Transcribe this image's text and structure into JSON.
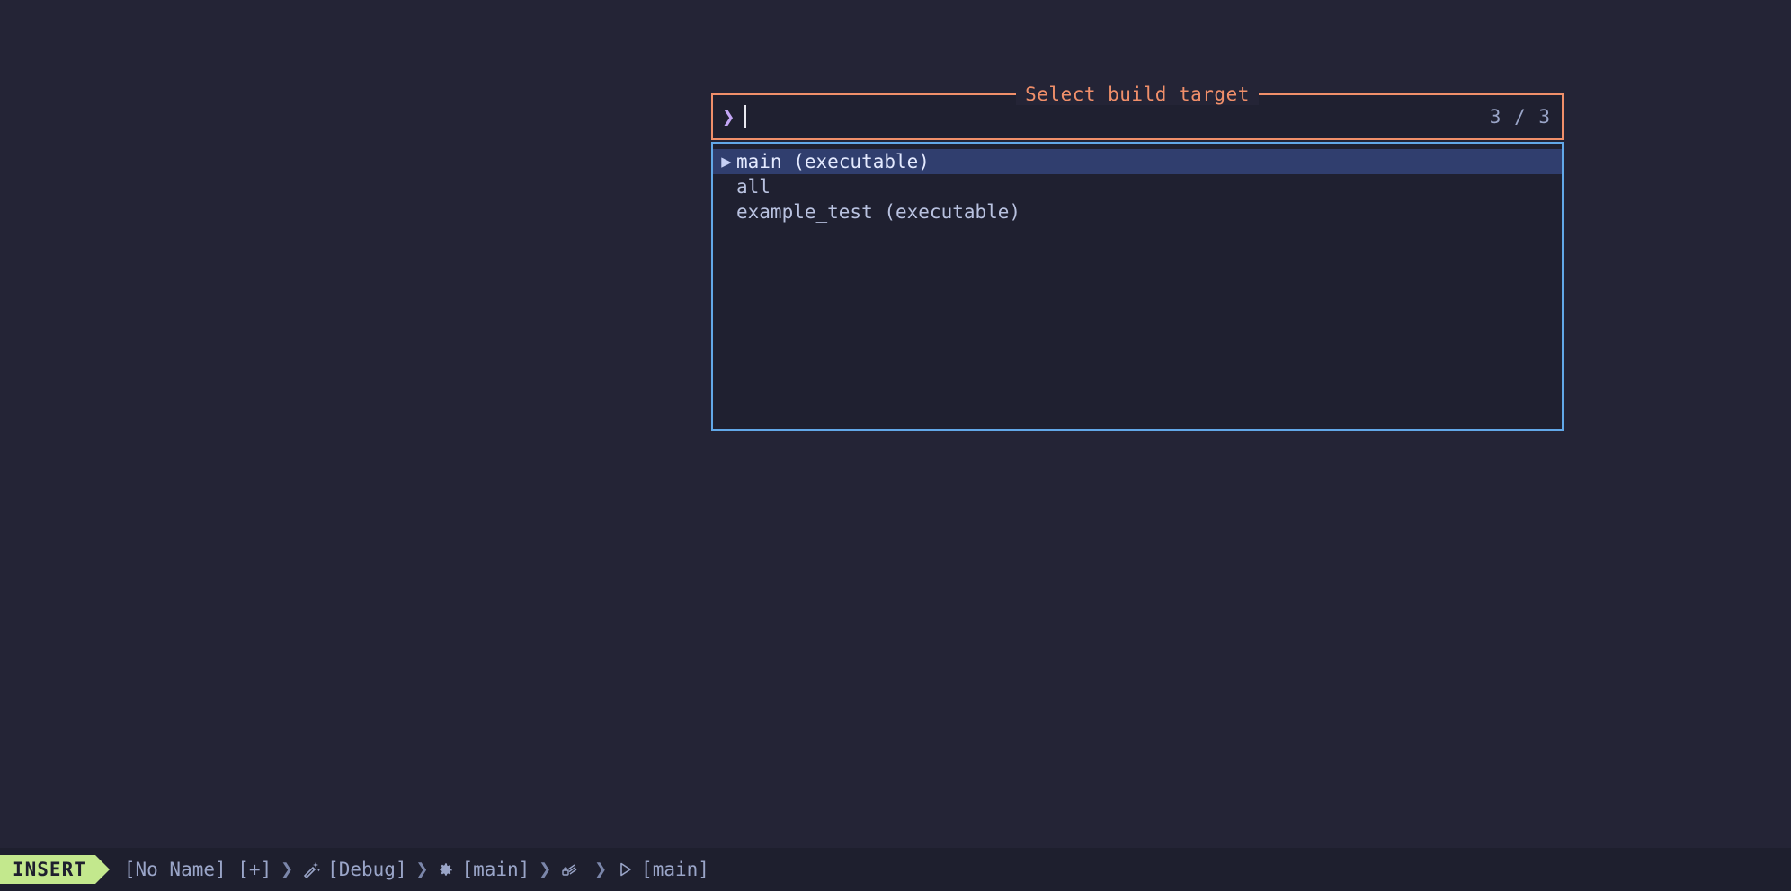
{
  "window": {
    "background_color": "#242436"
  },
  "picker": {
    "title": "Select build target",
    "title_color": "#f08f6a",
    "prompt": {
      "chevron": "❯",
      "value": "",
      "placeholder": "",
      "counter": "3 / 3",
      "border_color": "#f08f6a"
    },
    "results": {
      "border_color": "#62a8e8",
      "selection_color": "#303e6e",
      "selected_index": 0,
      "marker": "▶",
      "items": [
        {
          "label": "main (executable)"
        },
        {
          "label": "all"
        },
        {
          "label": "example_test (executable)"
        }
      ]
    }
  },
  "status_line": {
    "mode": "INSERT",
    "mode_color": "#c3e88d",
    "segments": [
      {
        "icon": null,
        "icon_name": "none",
        "text": "[No Name] [+]"
      },
      {
        "icon": "✨",
        "icon_name": "magic-wand-icon",
        "text": "[Debug]"
      },
      {
        "icon": "⚙",
        "icon_name": "gear-icon",
        "text": "[main]"
      },
      {
        "icon": "⚒",
        "icon_name": "build-hammer-icon",
        "text": ""
      },
      {
        "icon": "▷",
        "icon_name": "play-icon",
        "text": "[main]"
      }
    ],
    "separator": "❯"
  }
}
